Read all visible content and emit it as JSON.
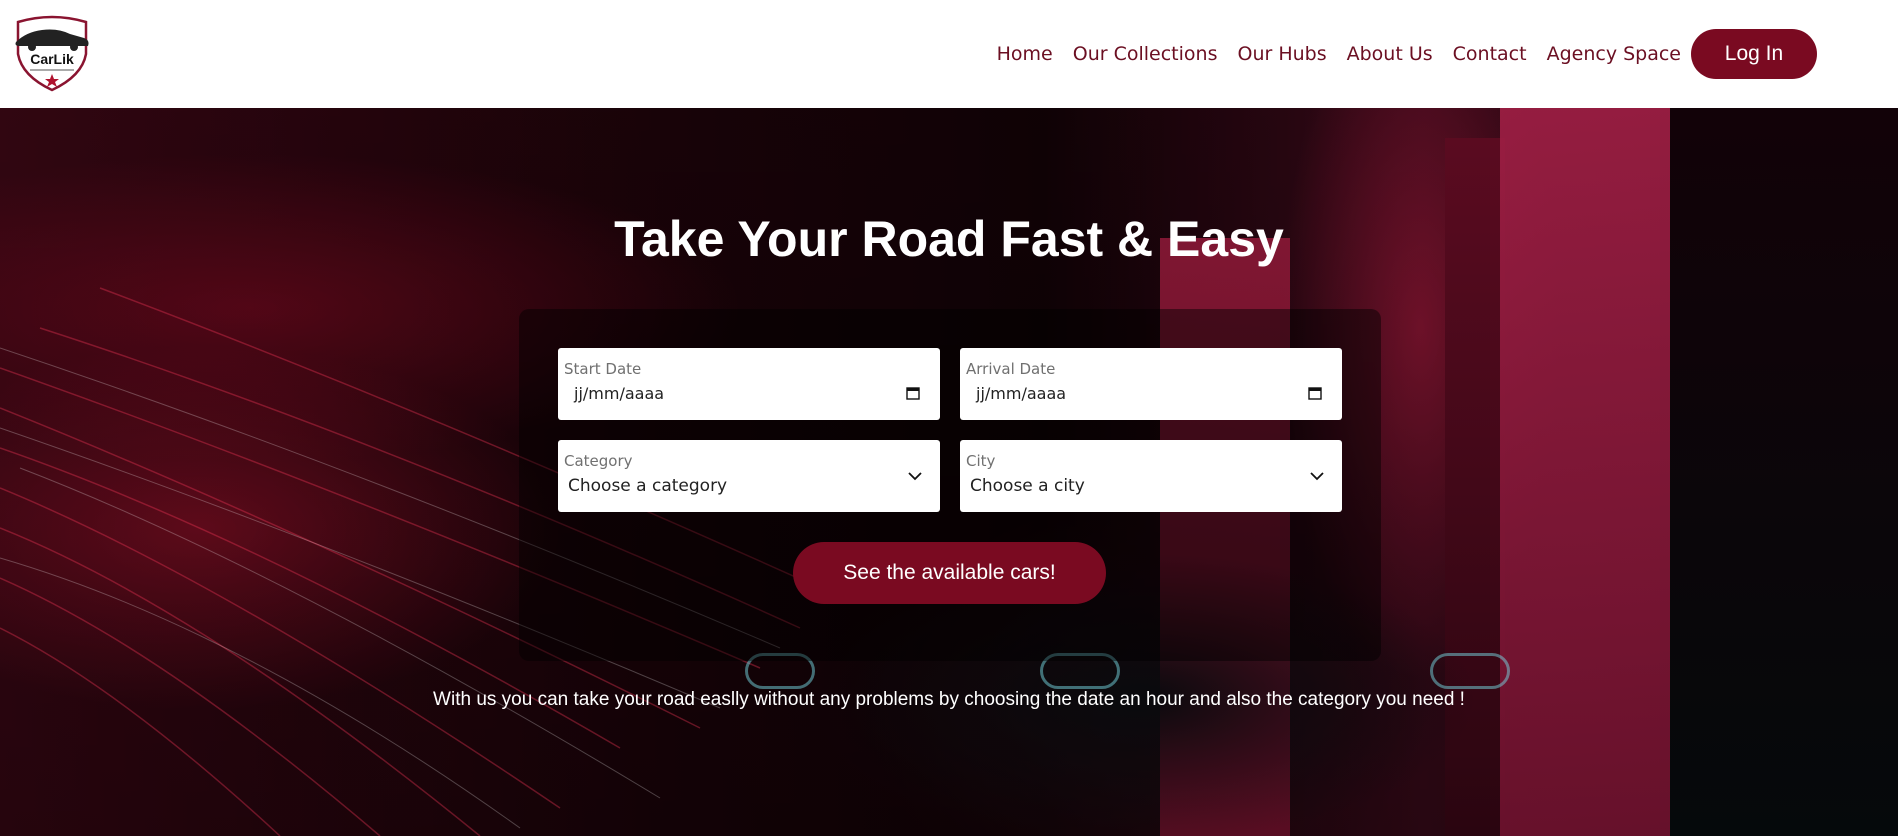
{
  "brand": {
    "logo_text": "CarLik",
    "tagline": "Take Your Road Fast & Easy",
    "color": "#7a0a21"
  },
  "nav": {
    "links": [
      "Home",
      "Our Collections",
      "Our Hubs",
      "About Us",
      "Contact",
      "Agency Space"
    ],
    "login_label": "Log In"
  },
  "hero": {
    "title": "Take Your Road Fast & Easy",
    "description": "With us you can take your road easlly without any problems by choosing the date an hour and also the category you need !"
  },
  "form": {
    "start_date": {
      "label": "Start Date",
      "value": "jj/mm/aaaa",
      "icon": "calendar-icon"
    },
    "arrival_date": {
      "label": "Arrival Date",
      "value": "jj/mm/aaaa",
      "icon": "calendar-icon"
    },
    "category": {
      "label": "Category",
      "selected": "Choose a category",
      "icon": "chevron-down-icon"
    },
    "city": {
      "label": "City",
      "selected": "Choose a city",
      "icon": "chevron-down-icon"
    },
    "submit_label": "See the available cars!"
  }
}
